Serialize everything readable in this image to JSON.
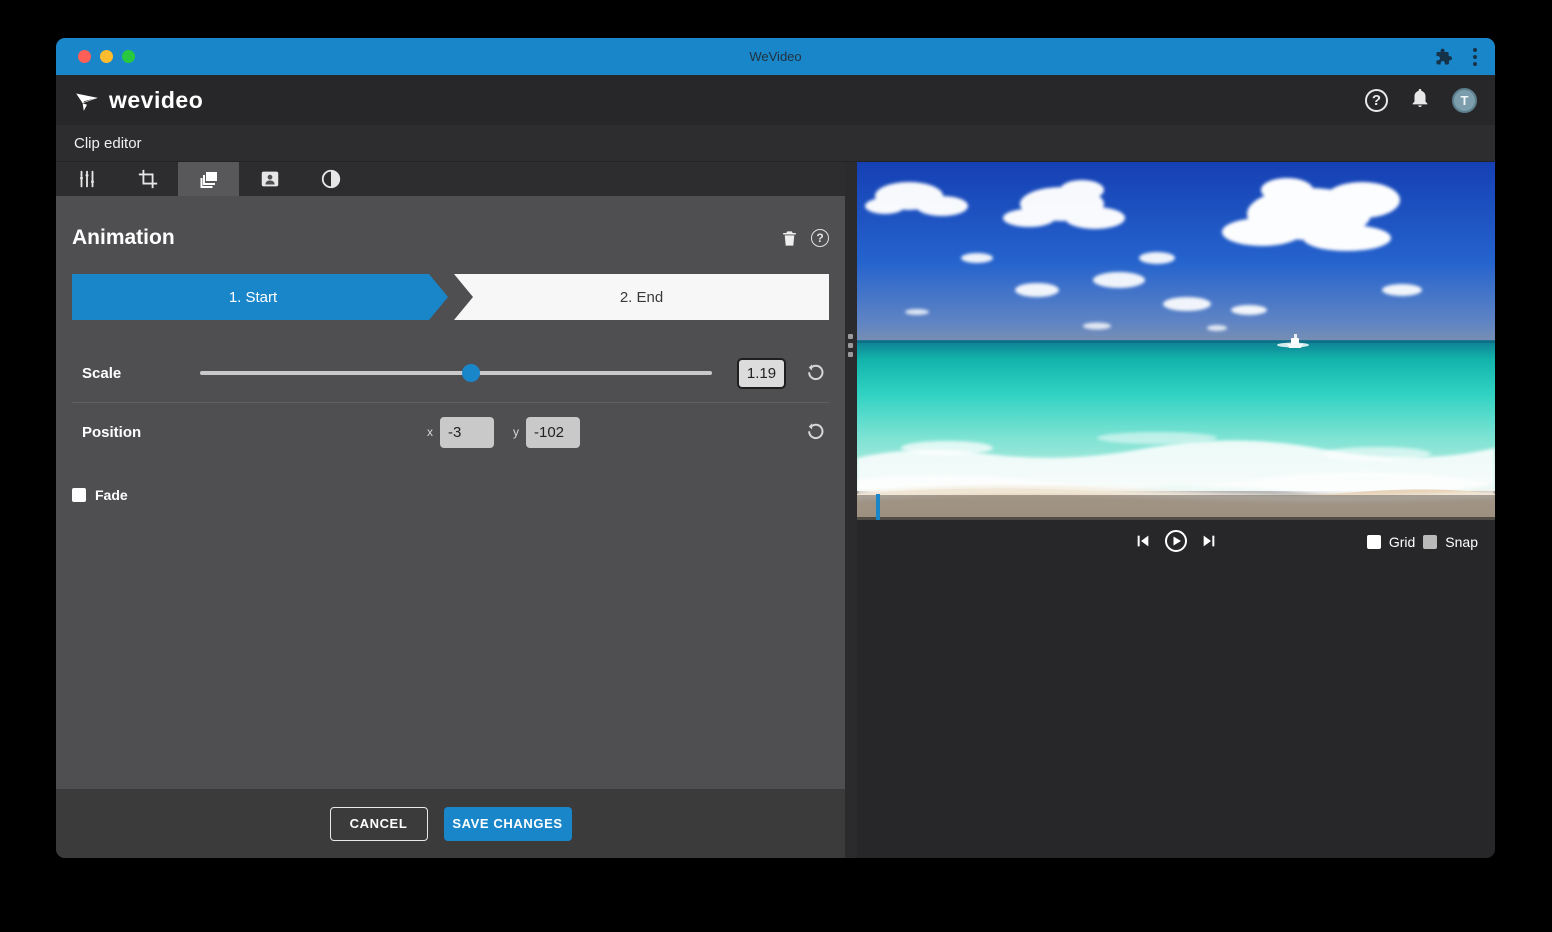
{
  "colors": {
    "accent_blue": "#1a86ca",
    "panel_gray": "#4f4f51",
    "footer_gray": "#3b3b3b",
    "header_dark": "#272729"
  },
  "titlebar": {
    "title": "WeVideo"
  },
  "header": {
    "logo_text": "wevideo",
    "avatar_letter": "T",
    "help_glyph": "?"
  },
  "breadcrumb": {
    "label": "Clip editor"
  },
  "tabs": {
    "items": [
      {
        "name": "adjust"
      },
      {
        "name": "crop"
      },
      {
        "name": "animation",
        "active": true
      },
      {
        "name": "portrait"
      },
      {
        "name": "contrast"
      }
    ]
  },
  "panel": {
    "title": "Animation",
    "help_glyph": "?",
    "steps": {
      "start": "1. Start",
      "end": "2. End"
    },
    "scale": {
      "label": "Scale",
      "value": "1.19",
      "slider_percent": 53
    },
    "position": {
      "label": "Position",
      "x_label": "x",
      "x_value": "-3",
      "y_label": "y",
      "y_value": "-102"
    },
    "fade": {
      "label": "Fade",
      "checked": false
    }
  },
  "footer": {
    "cancel_label": "CANCEL",
    "save_label": "SAVE CHANGES"
  },
  "preview": {
    "description": "tropical beach: blue sky with clouds, turquoise sea, white boat on horizon, sandy shore",
    "grid_label": "Grid",
    "snap_label": "Snap"
  }
}
